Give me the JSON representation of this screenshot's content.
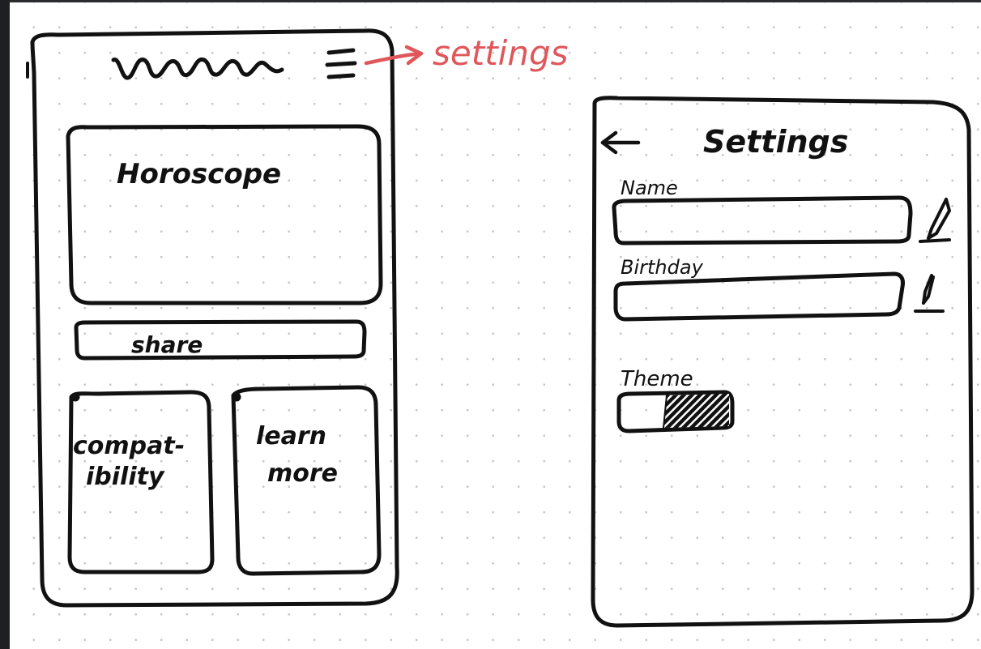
{
  "annotation": {
    "settings_link": "settings",
    "color": "#e0575b"
  },
  "home_screen": {
    "logo_icon": "scribble-logo-icon",
    "menu_icon": "hamburger-menu-icon",
    "horoscope_card": "Horoscope",
    "share_button": "share",
    "compatibility_card": [
      "compat-",
      "ibility"
    ],
    "learn_more_card": [
      "learn",
      "more"
    ]
  },
  "settings_screen": {
    "back_icon": "arrow-left-icon",
    "title": "Settings",
    "name_label": "Name",
    "name_edit_icon": "pencil-icon",
    "birthday_label": "Birthday",
    "birthday_edit_icon": "pencil-icon",
    "theme_label": "Theme",
    "theme_toggle_icon": "toggle-switch-icon"
  }
}
